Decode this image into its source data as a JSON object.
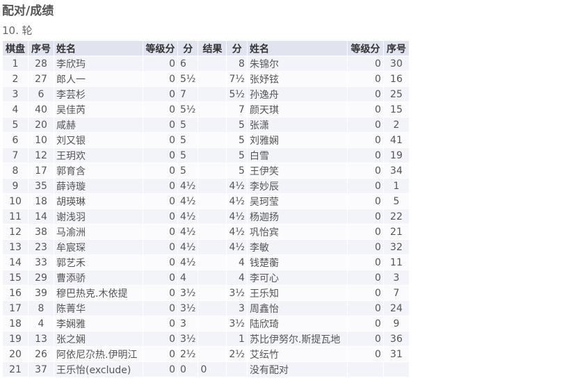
{
  "page": {
    "title": "配对/成绩",
    "round": "10. 轮"
  },
  "table": {
    "headers": {
      "board": "棋盘",
      "white_seq": "序号",
      "white_name": "姓名",
      "white_rating": "等级分",
      "white_pts": "分",
      "result": "结果",
      "black_pts": "分",
      "black_name": "姓名",
      "black_rating": "等级分",
      "black_seq": "序号"
    },
    "rows": [
      {
        "board": "1",
        "wseq": "28",
        "wname": "李欣玙",
        "wrating": "0",
        "wpts": "6",
        "result": "",
        "bpts": "8",
        "bname": "朱锦尔",
        "brating": "0",
        "bseq": "30"
      },
      {
        "board": "2",
        "wseq": "27",
        "wname": "郎人一",
        "wrating": "0",
        "wpts": "5½",
        "result": "",
        "bpts": "7½",
        "bname": "张妤铉",
        "brating": "0",
        "bseq": "16"
      },
      {
        "board": "3",
        "wseq": "6",
        "wname": "李芸杉",
        "wrating": "0",
        "wpts": "7",
        "result": "",
        "bpts": "5½",
        "bname": "孙逸舟",
        "brating": "0",
        "bseq": "25"
      },
      {
        "board": "4",
        "wseq": "40",
        "wname": "吴佳芮",
        "wrating": "0",
        "wpts": "5½",
        "result": "",
        "bpts": "7",
        "bname": "颜天琪",
        "brating": "0",
        "bseq": "15"
      },
      {
        "board": "5",
        "wseq": "20",
        "wname": "咸赫",
        "wrating": "0",
        "wpts": "5",
        "result": "",
        "bpts": "5",
        "bname": "张潇",
        "brating": "0",
        "bseq": "2"
      },
      {
        "board": "6",
        "wseq": "10",
        "wname": "刘又银",
        "wrating": "0",
        "wpts": "5",
        "result": "",
        "bpts": "5",
        "bname": "刘雅娴",
        "brating": "0",
        "bseq": "41"
      },
      {
        "board": "7",
        "wseq": "12",
        "wname": "王玥欢",
        "wrating": "0",
        "wpts": "5",
        "result": "",
        "bpts": "5",
        "bname": "白雪",
        "brating": "0",
        "bseq": "19"
      },
      {
        "board": "8",
        "wseq": "17",
        "wname": "郭育含",
        "wrating": "0",
        "wpts": "5",
        "result": "",
        "bpts": "5",
        "bname": "王伊笑",
        "brating": "0",
        "bseq": "34"
      },
      {
        "board": "9",
        "wseq": "35",
        "wname": "薛诗璇",
        "wrating": "0",
        "wpts": "4½",
        "result": "",
        "bpts": "4½",
        "bname": "李妙辰",
        "brating": "0",
        "bseq": "1"
      },
      {
        "board": "10",
        "wseq": "18",
        "wname": "胡瑛琳",
        "wrating": "0",
        "wpts": "4½",
        "result": "",
        "bpts": "4½",
        "bname": "吴珂莹",
        "brating": "0",
        "bseq": "5"
      },
      {
        "board": "11",
        "wseq": "14",
        "wname": "谢浅羽",
        "wrating": "0",
        "wpts": "4½",
        "result": "",
        "bpts": "4½",
        "bname": "杨迦扬",
        "brating": "0",
        "bseq": "22"
      },
      {
        "board": "12",
        "wseq": "38",
        "wname": "马渝洲",
        "wrating": "0",
        "wpts": "4½",
        "result": "",
        "bpts": "4½",
        "bname": "巩怡宾",
        "brating": "0",
        "bseq": "21"
      },
      {
        "board": "13",
        "wseq": "23",
        "wname": "牟宸琛",
        "wrating": "0",
        "wpts": "4½",
        "result": "",
        "bpts": "4½",
        "bname": "李敏",
        "brating": "0",
        "bseq": "32"
      },
      {
        "board": "14",
        "wseq": "33",
        "wname": "郭艺禾",
        "wrating": "0",
        "wpts": "4½",
        "result": "",
        "bpts": "4",
        "bname": "钱楚蘅",
        "brating": "0",
        "bseq": "11"
      },
      {
        "board": "15",
        "wseq": "29",
        "wname": "曹添骄",
        "wrating": "0",
        "wpts": "4",
        "result": "",
        "bpts": "4",
        "bname": "李可心",
        "brating": "0",
        "bseq": "3"
      },
      {
        "board": "16",
        "wseq": "39",
        "wname": "穆巴热克.木依提",
        "wrating": "0",
        "wpts": "3½",
        "result": "",
        "bpts": "3½",
        "bname": "王乐知",
        "brating": "0",
        "bseq": "7"
      },
      {
        "board": "17",
        "wseq": "8",
        "wname": "陈菁华",
        "wrating": "0",
        "wpts": "3½",
        "result": "",
        "bpts": "3",
        "bname": "周鑫怡",
        "brating": "0",
        "bseq": "24"
      },
      {
        "board": "18",
        "wseq": "4",
        "wname": "李娴雅",
        "wrating": "0",
        "wpts": "3",
        "result": "",
        "bpts": "3½",
        "bname": "陆欣琦",
        "brating": "0",
        "bseq": "9"
      },
      {
        "board": "19",
        "wseq": "13",
        "wname": "张之娴",
        "wrating": "0",
        "wpts": "3½",
        "result": "",
        "bpts": "1",
        "bname": "苏比伊努尔.斯提瓦地",
        "brating": "0",
        "bseq": "36"
      },
      {
        "board": "20",
        "wseq": "26",
        "wname": "阿依尼尕热.伊明江",
        "wrating": "0",
        "wpts": "2½",
        "result": "",
        "bpts": "2½",
        "bname": "艾纭竹",
        "brating": "0",
        "bseq": "31"
      },
      {
        "board": "21",
        "wseq": "37",
        "wname": "王乐怡(exclude)",
        "wrating": "0",
        "wpts": "0",
        "result": "0",
        "bpts": "",
        "bname": "没有配对",
        "brating": "",
        "bseq": "",
        "bye": true
      }
    ]
  }
}
